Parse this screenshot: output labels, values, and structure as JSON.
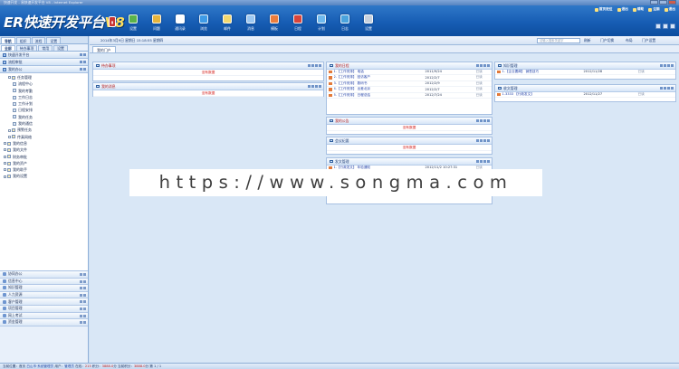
{
  "window": {
    "title": "快速开发 - 易快速开发平台 V8 - Internet Explorer"
  },
  "header": {
    "logo_text": "ER快速开发平台",
    "logo_version": "V8",
    "toolbar": [
      {
        "label": "设置",
        "icon": "settings-icon",
        "color": "#5ab34a"
      },
      {
        "label": "问题",
        "icon": "question-icon",
        "color": "#e6b43c"
      },
      {
        "label": "通讯录",
        "icon": "address-book-icon",
        "color": "#ffffff"
      },
      {
        "label": "浏览",
        "icon": "browser-icon",
        "color": "#3f9be6"
      },
      {
        "label": "邮件",
        "icon": "mail-icon",
        "color": "#f3d86f"
      },
      {
        "label": "消息",
        "icon": "message-icon",
        "color": "#9ec9f2"
      },
      {
        "label": "模板",
        "icon": "template-icon",
        "color": "#ec7d3d"
      },
      {
        "label": "日程",
        "icon": "calendar-icon",
        "color": "#d9443a"
      },
      {
        "label": "计划",
        "icon": "plan-icon",
        "color": "#6fb9ee"
      },
      {
        "label": "日志",
        "icon": "log-icon",
        "color": "#4ba3dd"
      },
      {
        "label": "设置",
        "icon": "gear-icon",
        "color": "#c8d2de"
      }
    ],
    "top_links": [
      "首页定位",
      "退出",
      "帮助",
      "注销",
      "退出"
    ]
  },
  "left": {
    "nav_tabs": [
      "导航",
      "组织",
      "流程",
      "设置"
    ],
    "sub_tabs": [
      "全部",
      "待办事项",
      "常用",
      "设置"
    ],
    "panel_items": [
      "快速开发平台",
      "流程审批",
      "我的办公"
    ],
    "tree": [
      {
        "label": "任务管理",
        "level": 1,
        "type": "folder"
      },
      {
        "label": "流程中心",
        "level": 2,
        "type": "doc"
      },
      {
        "label": "我的考勤",
        "level": 2,
        "type": "doc"
      },
      {
        "label": "工作日志",
        "level": 2,
        "type": "doc"
      },
      {
        "label": "工作计划",
        "level": 2,
        "type": "doc"
      },
      {
        "label": "日程安排",
        "level": 2,
        "type": "doc"
      },
      {
        "label": "我的任务",
        "level": 2,
        "type": "doc"
      },
      {
        "label": "我的通信",
        "level": 2,
        "type": "doc"
      },
      {
        "label": "预警任务",
        "level": 1,
        "type": "folder"
      },
      {
        "label": "传真网络",
        "level": 1,
        "type": "folder"
      },
      {
        "label": "我的信息",
        "level": 0,
        "type": "folder"
      },
      {
        "label": "我的文件",
        "level": 0,
        "type": "folder"
      },
      {
        "label": "财务审批",
        "level": 0,
        "type": "folder"
      },
      {
        "label": "我的资产",
        "level": 0,
        "type": "folder"
      },
      {
        "label": "我的助手",
        "level": 0,
        "type": "folder"
      },
      {
        "label": "我的设置",
        "level": 0,
        "type": "folder"
      }
    ],
    "bottom_nav": [
      "协同办公",
      "信息中心",
      "知识管理",
      "人力资源",
      "客户管理",
      "项目管理",
      "网上考试",
      "资金管理"
    ]
  },
  "main": {
    "bar_text": "2014年3月9日 星期日 15:18:55 星期四",
    "search_placeholder": "请输入搜索关键字",
    "bar_actions": [
      "刷新",
      "门户切换",
      "布局",
      "门户设置"
    ],
    "portal_tab": "我的门户",
    "portlets": {
      "col1_top": {
        "title": "待办事项",
        "empty": "没有数据"
      },
      "col1_mid": {
        "title": "我的消息",
        "empty": "没有数据"
      },
      "schedule": {
        "title": "我的日程",
        "rows": [
          {
            "n": "1.",
            "text": "【工作安排】 电话",
            "date": "2011/9/24",
            "status": "已读"
          },
          {
            "n": "2.",
            "text": "【工作安排】 回访客户",
            "date": "2012/2/7",
            "status": "已读"
          },
          {
            "n": "3.",
            "text": "【工作安排】 数码书",
            "date": "2012/2/9",
            "status": "已读"
          },
          {
            "n": "4.",
            "text": "【工作安排】 出差北京",
            "date": "2012/2/7",
            "status": "已读"
          },
          {
            "n": "5.",
            "text": "【工作安排】 日程总结",
            "date": "2012/7/24",
            "status": "已读"
          }
        ]
      },
      "notice": {
        "title": "我的公告",
        "empty": "没有数据"
      },
      "meeting": {
        "title": "会议纪要",
        "empty": "没有数据"
      },
      "docs": {
        "title": "发文管理",
        "rows": [
          {
            "n": "1.",
            "text": "【行政发文】 年检通知",
            "date": "2012/11/2 10:27:31",
            "status": "已读"
          },
          {
            "n": "2.",
            "text": "【行政发文】 公司章程",
            "date": "2012/11/1",
            "status": "已读"
          },
          {
            "n": "3.",
            "text": "【行政发文】 规章制度",
            "date": "2012/11/20",
            "status": "已读"
          },
          {
            "n": "4.",
            "text": "【行政发文】 发文待签",
            "date": "2012/11/20",
            "status": "已读"
          }
        ]
      },
      "notify": {
        "title": "知识管理",
        "rows": [
          {
            "n": "1.",
            "text": "【企业要闻】 销售技巧",
            "date": "2012/11/28",
            "status": "已读"
          }
        ]
      },
      "inbox": {
        "title": "收文管理",
        "rows": [
          {
            "n": "1.",
            "text": "3333 【行政发文】",
            "date": "2012/11/27",
            "status": "已读"
          }
        ]
      }
    }
  },
  "watermark": "https://www.songma.com",
  "status": {
    "prefix": "当前位置：首页",
    "company": "白山市·系统管理员",
    "user_label": "用户：",
    "user": "管理员",
    "online_label": "在线：",
    "online": "215",
    "score_label": "积分：",
    "score": "3888.0",
    "unit": "分",
    "points_label": "当前积分：",
    "points": "3888.0",
    "extra": "第 1 / 1"
  }
}
